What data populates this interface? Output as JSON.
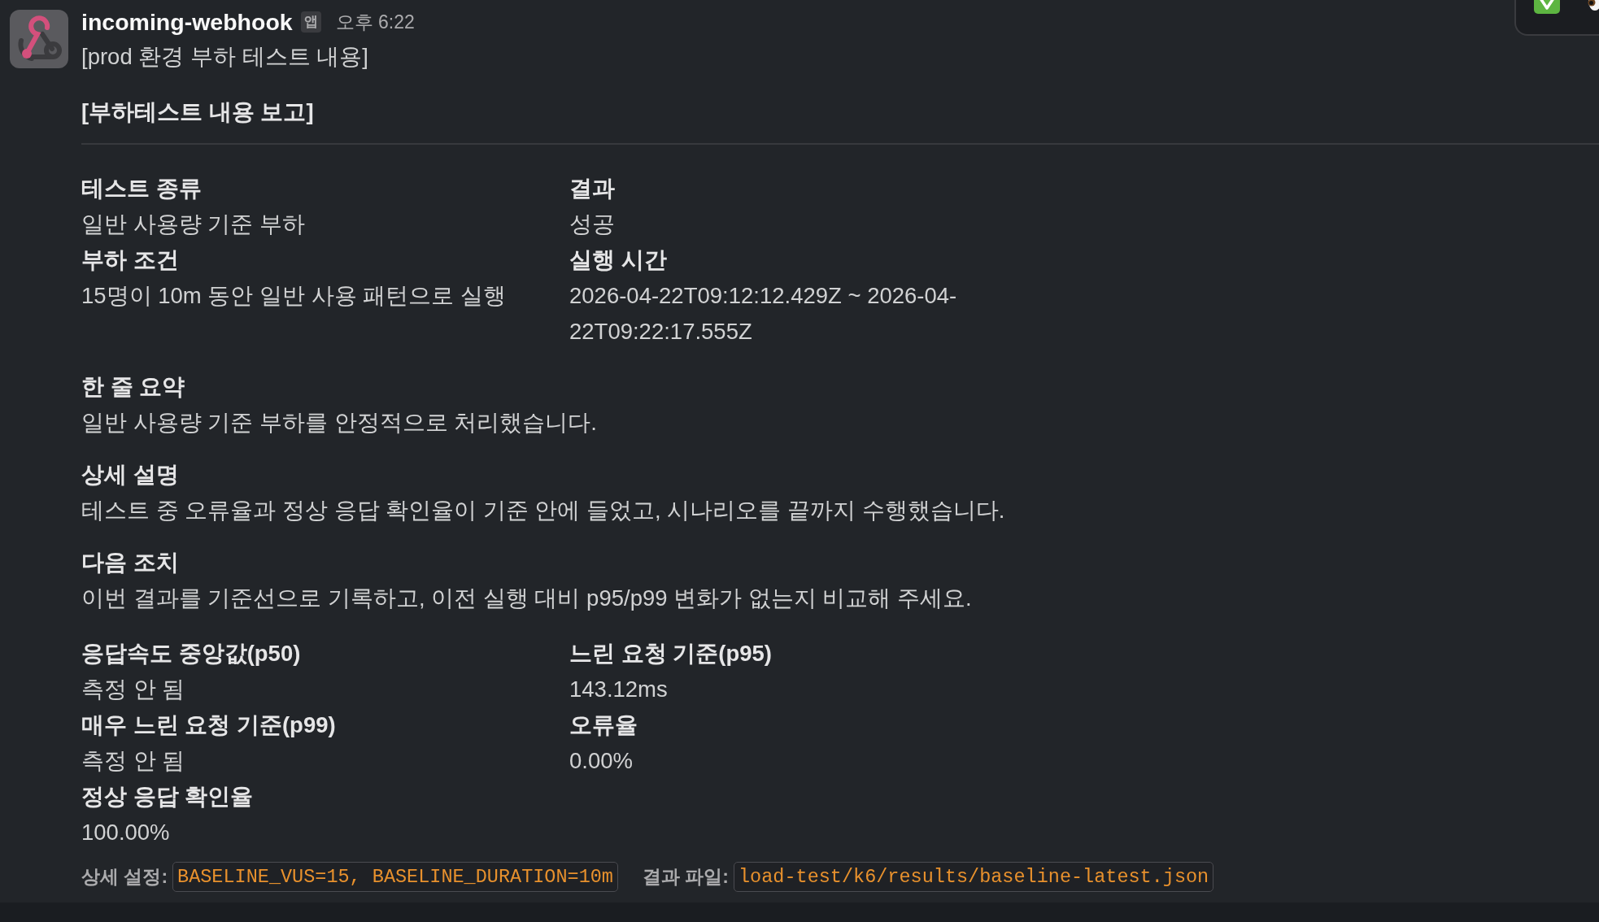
{
  "message": {
    "sender": "incoming-webhook",
    "app_badge": "앱",
    "time": "오후 6:22",
    "text": "[prod 환경 부하 테스트 내용]",
    "blocks": [
      {
        "kind": "header",
        "text": "[부하테스트 내용 보고]"
      },
      {
        "kind": "divider"
      },
      {
        "kind": "fields",
        "fields": [
          {
            "label": "테스트 종류",
            "value": "일반 사용량 기준 부하"
          },
          {
            "label": "결과",
            "value": "성공"
          },
          {
            "label": "부하 조건",
            "value": "15명이 10m 동안 일반 사용 패턴으로 실행"
          },
          {
            "label": "실행 시간",
            "value": "2026-04-22T09:12:12.429Z ~ 2026-04-22T09:22:17.555Z"
          }
        ]
      },
      {
        "kind": "section",
        "label": "한 줄 요약",
        "text": "일반 사용량 기준 부하를 안정적으로 처리했습니다."
      },
      {
        "kind": "section",
        "label": "상세 설명",
        "text": "테스트 중 오류율과 정상 응답 확인율이 기준 안에 들었고, 시나리오를 끝까지 수행했습니다."
      },
      {
        "kind": "section",
        "label": "다음 조치",
        "text": "이번 결과를 기준선으로 기록하고, 이전 실행 대비 p95/p99 변화가 없는지 비교해 주세요."
      },
      {
        "kind": "fields",
        "fields": [
          {
            "label": "응답속도 중앙값(p50)",
            "value": "측정 안 됨"
          },
          {
            "label": "느린 요청 기준(p95)",
            "value": "143.12ms"
          },
          {
            "label": "매우 느린 요청 기준(p99)",
            "value": "측정 안 됨"
          },
          {
            "label": "오류율",
            "value": "0.00%"
          },
          {
            "label": "정상 응답 확인율",
            "value": "100.00%"
          }
        ]
      },
      {
        "kind": "context",
        "items": [
          {
            "label": "상세 설정:",
            "code": "BASELINE_VUS=15, BASELINE_DURATION=10m"
          },
          {
            "label": "결과 파일:",
            "code": "load-test/k6/results/baseline-latest.json"
          }
        ]
      }
    ]
  }
}
